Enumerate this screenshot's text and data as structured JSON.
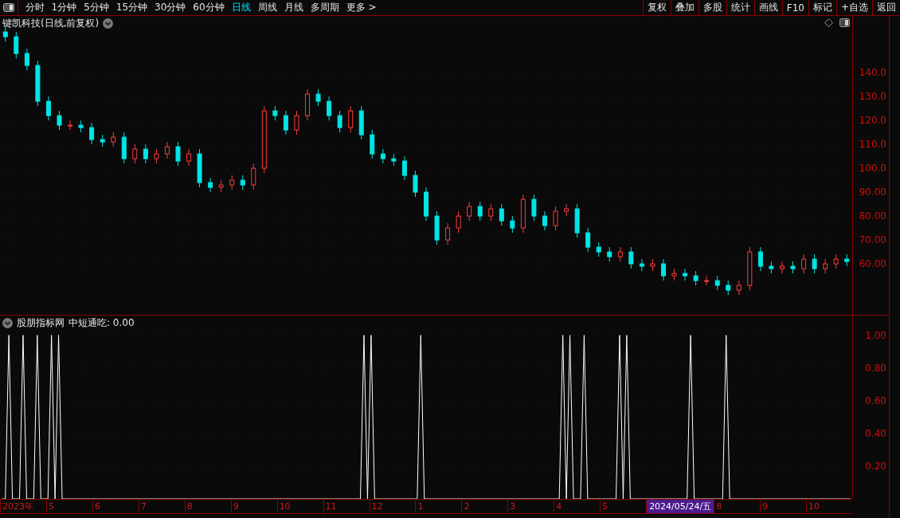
{
  "toolbar": {
    "periods": [
      {
        "label": "分时",
        "selected": false
      },
      {
        "label": "1分钟",
        "selected": false
      },
      {
        "label": "5分钟",
        "selected": false
      },
      {
        "label": "15分钟",
        "selected": false
      },
      {
        "label": "30分钟",
        "selected": false
      },
      {
        "label": "60分钟",
        "selected": false
      },
      {
        "label": "日线",
        "selected": true
      },
      {
        "label": "周线",
        "selected": false
      },
      {
        "label": "月线",
        "selected": false
      },
      {
        "label": "多周期",
        "selected": false
      },
      {
        "label": "更多 >",
        "selected": false
      }
    ],
    "buttons": [
      "复权",
      "叠加",
      "多股",
      "统计",
      "画线",
      "F10",
      "标记",
      "+自选",
      "返回"
    ]
  },
  "price_panel": {
    "title": "键凯科技(日线,前复权)",
    "chart_data": {
      "type": "candlestick",
      "grid": true,
      "ylim": [
        38.7,
        163.7
      ],
      "yticks": [
        {
          "value": 140,
          "label": "140.0"
        },
        {
          "value": 130,
          "label": "130.0"
        },
        {
          "value": 120,
          "label": "120.0"
        },
        {
          "value": 110,
          "label": "110.0"
        },
        {
          "value": 100,
          "label": "100.0"
        },
        {
          "value": 90,
          "label": "90.00"
        },
        {
          "value": 80,
          "label": "80.00"
        },
        {
          "value": 70,
          "label": "70.00"
        },
        {
          "value": 60,
          "label": "60.00"
        }
      ],
      "ohlc": [
        [
          157,
          159,
          153,
          155
        ],
        [
          155,
          157,
          146,
          148
        ],
        [
          148,
          150,
          141,
          143
        ],
        [
          143,
          145,
          126,
          128
        ],
        [
          128,
          130,
          120,
          122
        ],
        [
          122,
          124,
          116,
          118
        ],
        [
          118,
          120,
          116,
          118
        ],
        [
          118,
          120,
          115,
          117
        ],
        [
          117,
          119,
          110,
          112
        ],
        [
          112,
          114,
          109,
          111
        ],
        [
          111,
          115,
          109,
          113
        ],
        [
          113,
          115,
          102,
          104
        ],
        [
          104,
          110,
          102,
          108
        ],
        [
          108,
          110,
          102,
          104
        ],
        [
          104,
          108,
          102,
          106
        ],
        [
          106,
          111,
          104,
          109
        ],
        [
          109,
          111,
          101,
          103
        ],
        [
          103,
          108,
          101,
          106
        ],
        [
          106,
          108,
          92,
          94
        ],
        [
          94,
          96,
          90,
          92
        ],
        [
          92,
          95,
          90,
          93
        ],
        [
          93,
          97,
          91,
          95
        ],
        [
          95,
          97,
          91,
          93
        ],
        [
          93,
          102,
          91,
          100
        ],
        [
          100,
          126,
          98,
          124
        ],
        [
          124,
          126,
          120,
          122
        ],
        [
          122,
          124,
          114,
          116
        ],
        [
          116,
          124,
          114,
          122
        ],
        [
          122,
          133,
          120,
          131
        ],
        [
          131,
          133,
          126,
          128
        ],
        [
          128,
          130,
          120,
          122
        ],
        [
          122,
          124,
          115,
          117
        ],
        [
          117,
          126,
          115,
          124
        ],
        [
          124,
          126,
          112,
          114
        ],
        [
          114,
          116,
          104,
          106
        ],
        [
          106,
          108,
          102,
          104
        ],
        [
          104,
          106,
          101,
          103
        ],
        [
          103,
          105,
          95,
          97
        ],
        [
          97,
          99,
          88,
          90
        ],
        [
          90,
          92,
          78,
          80
        ],
        [
          80,
          82,
          68,
          70
        ],
        [
          70,
          77,
          68,
          75
        ],
        [
          75,
          82,
          73,
          80
        ],
        [
          80,
          86,
          78,
          84
        ],
        [
          84,
          86,
          78,
          80
        ],
        [
          80,
          85,
          78,
          83
        ],
        [
          83,
          85,
          76,
          78
        ],
        [
          78,
          80,
          73,
          75
        ],
        [
          75,
          89,
          73,
          87
        ],
        [
          87,
          89,
          78,
          80
        ],
        [
          80,
          82,
          74,
          76
        ],
        [
          76,
          84,
          74,
          82
        ],
        [
          82,
          85,
          80,
          83
        ],
        [
          83,
          85,
          71,
          73
        ],
        [
          73,
          75,
          65,
          67
        ],
        [
          67,
          69,
          63,
          65
        ],
        [
          65,
          67,
          61,
          63
        ],
        [
          63,
          67,
          61,
          65
        ],
        [
          65,
          67,
          58,
          60
        ],
        [
          60,
          62,
          57,
          59
        ],
        [
          59,
          62,
          57,
          60
        ],
        [
          60,
          62,
          53,
          55
        ],
        [
          55,
          58,
          53,
          56
        ],
        [
          56,
          58,
          53,
          55
        ],
        [
          55,
          57,
          51,
          53
        ],
        [
          53,
          55,
          51,
          53
        ],
        [
          53,
          55,
          49,
          51
        ],
        [
          51,
          53,
          47,
          49
        ],
        [
          49,
          53,
          47,
          51
        ],
        [
          51,
          67,
          49,
          65
        ],
        [
          65,
          67,
          57,
          59
        ],
        [
          59,
          61,
          56,
          58
        ],
        [
          58,
          61,
          56,
          59
        ],
        [
          59,
          61,
          56,
          58
        ],
        [
          58,
          64,
          56,
          62
        ],
        [
          62,
          64,
          56,
          58
        ],
        [
          58,
          62,
          56,
          60
        ],
        [
          60,
          64,
          58,
          62
        ],
        [
          62,
          64,
          59,
          61
        ]
      ]
    }
  },
  "indicator_panel": {
    "name": "股朋指标网",
    "reading": "中短通吃: 0.00",
    "chart_data": {
      "type": "line",
      "grid": true,
      "ylim": [
        0,
        1.12
      ],
      "yticks": [
        {
          "value": 1,
          "label": "1.00"
        },
        {
          "value": 0.8,
          "label": "0.80"
        },
        {
          "value": 0.6,
          "label": "0.60"
        },
        {
          "value": 0.4,
          "label": "0.40"
        },
        {
          "value": 0.2,
          "label": "0.20"
        }
      ],
      "values": [
        0,
        0,
        1,
        0,
        0,
        0,
        1,
        0,
        0,
        0,
        1,
        0,
        0,
        0,
        1,
        0,
        1,
        0,
        0,
        0,
        0,
        0,
        0,
        0,
        0,
        0,
        0,
        0,
        0,
        0,
        0,
        0,
        0,
        0,
        0,
        0,
        0,
        0,
        0,
        0,
        0,
        0,
        0,
        0,
        0,
        0,
        0,
        0,
        0,
        0,
        0,
        0,
        0,
        0,
        0,
        0,
        0,
        0,
        0,
        0,
        0,
        0,
        0,
        0,
        0,
        0,
        0,
        0,
        0,
        0,
        0,
        0,
        0,
        0,
        0,
        0,
        0,
        0,
        0,
        0,
        0,
        0,
        0,
        0,
        0,
        0,
        0,
        0,
        0,
        0,
        0,
        0,
        0,
        0,
        0,
        0,
        0,
        0,
        0,
        0,
        0,
        0,
        1,
        0,
        1,
        0,
        0,
        0,
        0,
        0,
        0,
        0,
        0,
        0,
        0,
        0,
        0,
        0,
        1,
        0,
        0,
        0,
        0,
        0,
        0,
        0,
        0,
        0,
        0,
        0,
        0,
        0,
        0,
        0,
        0,
        0,
        0,
        0,
        0,
        0,
        0,
        0,
        0,
        0,
        0,
        0,
        0,
        0,
        0,
        0,
        0,
        0,
        0,
        0,
        0,
        0,
        0,
        0,
        1,
        0,
        1,
        0,
        0,
        0,
        1,
        0,
        0,
        0,
        0,
        0,
        0,
        0,
        0,
        0,
        1,
        0,
        1,
        0,
        0,
        0,
        0,
        0,
        0,
        0,
        0,
        0,
        0,
        0,
        0,
        0,
        0,
        0,
        0,
        0,
        1,
        0,
        0,
        0,
        0,
        0,
        0,
        0,
        0,
        0,
        1,
        0,
        0,
        0,
        0,
        0,
        0,
        0,
        0,
        0,
        0,
        0,
        0,
        0,
        0,
        0,
        0,
        0,
        0,
        0,
        0,
        0,
        0,
        0,
        0,
        0,
        0,
        0,
        0,
        0,
        0,
        0,
        0,
        0,
        0,
        0
      ]
    }
  },
  "date_axis": [
    {
      "label": "2023年",
      "kind": "tick"
    },
    {
      "label": "5",
      "kind": "tick"
    },
    {
      "label": "6",
      "kind": "tick"
    },
    {
      "label": "7",
      "kind": "tick"
    },
    {
      "label": "8",
      "kind": "tick"
    },
    {
      "label": "9",
      "kind": "tick"
    },
    {
      "label": "10",
      "kind": "tick"
    },
    {
      "label": "11",
      "kind": "tick"
    },
    {
      "label": "12",
      "kind": "tick"
    },
    {
      "label": "1",
      "kind": "tick"
    },
    {
      "label": "2",
      "kind": "tick"
    },
    {
      "label": "3",
      "kind": "tick"
    },
    {
      "label": "4",
      "kind": "tick"
    },
    {
      "label": "5",
      "kind": "tick"
    },
    {
      "label": "2024/05/24/五",
      "kind": "cursor"
    },
    {
      "label": "8",
      "kind": "tick"
    },
    {
      "label": "9",
      "kind": "tick"
    },
    {
      "label": "10",
      "kind": "tick"
    }
  ]
}
